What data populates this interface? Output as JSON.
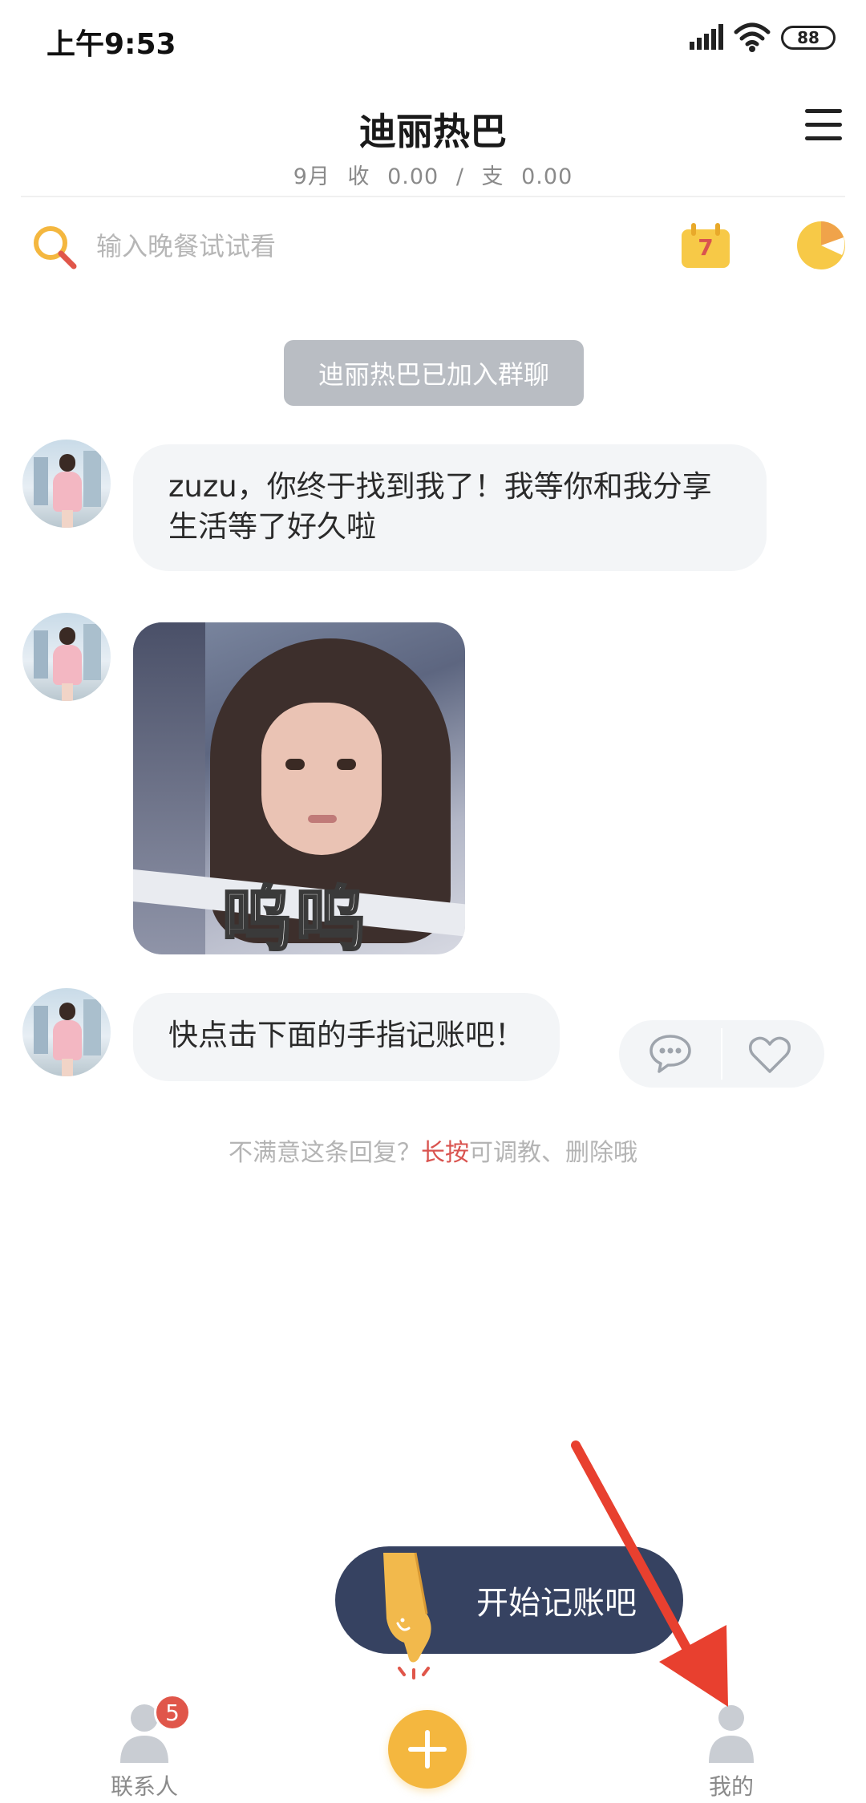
{
  "status_bar": {
    "time": "上午9:53",
    "battery": "88"
  },
  "header": {
    "title": "迪丽热巴",
    "month": "9月",
    "income_label": "收",
    "income_value": "0.00",
    "separator": "/",
    "expense_label": "支",
    "expense_value": "0.00"
  },
  "search": {
    "placeholder": "输入晚餐试试看"
  },
  "calendar": {
    "day": "7"
  },
  "notice": {
    "text": "迪丽热巴已加入群聊"
  },
  "messages": [
    {
      "text": "zuzu，你终于找到我了！我等你和我分享生活等了好久啦"
    },
    {
      "sticker_caption": "呜呜"
    },
    {
      "text": "快点击下面的手指记账吧！"
    }
  ],
  "hint": {
    "before": "不满意这条回复？",
    "emphasis": "长按",
    "after": "可调教、删除哦"
  },
  "cta": {
    "label": "开始记账吧"
  },
  "nav": {
    "contacts_label": "联系人",
    "contacts_badge": "5",
    "mine_label": "我的"
  },
  "colors": {
    "accent": "#f4b73f",
    "cta_bg": "#364261",
    "badge": "#e0564a",
    "emphasis": "#d9534f",
    "bubble": "#f3f5f7"
  }
}
